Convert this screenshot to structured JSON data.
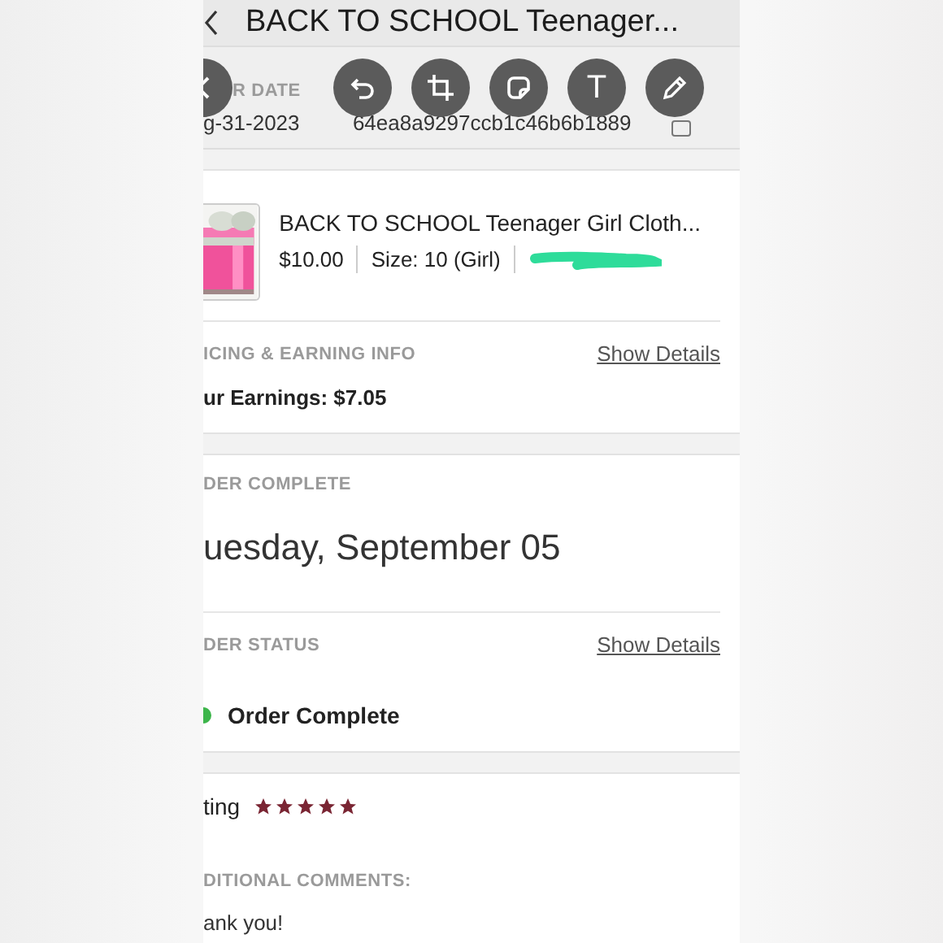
{
  "header": {
    "title": "BACK TO SCHOOL Teenager..."
  },
  "order_info": [
    {
      "label": "R DATE",
      "value": "g-31-2023"
    },
    {
      "value": "64ea8a9297ccb1c46b6b1889"
    }
  ],
  "product": {
    "title": "BACK TO SCHOOL Teenager Girl Cloth...",
    "price": "$10.00",
    "size": "Size: 10 (Girl)"
  },
  "earnings": {
    "heading": "ICING & EARNING INFO",
    "link": "Show Details",
    "text": "ur Earnings: $7.05"
  },
  "completion": {
    "heading": "DER COMPLETE",
    "date": "uesday, September 05"
  },
  "status": {
    "heading": "DER STATUS",
    "link": "Show Details",
    "label": "Order Complete",
    "color": "#3cb54a"
  },
  "rating": {
    "label": "ting",
    "stars": 5
  },
  "comments": {
    "heading": "DITIONAL COMMENTS:",
    "text": "ank you!"
  },
  "toolbar": [
    {
      "kind": "back"
    },
    {
      "kind": "undo"
    },
    {
      "kind": "crop"
    },
    {
      "kind": "sticker"
    },
    {
      "kind": "text",
      "label": "T"
    },
    {
      "kind": "draw"
    }
  ]
}
